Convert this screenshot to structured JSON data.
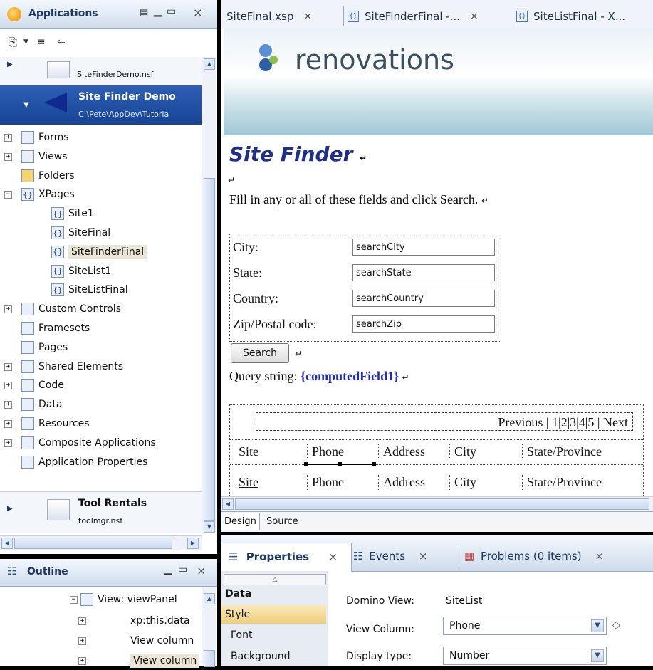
{
  "app_panel": {
    "title": "Applications",
    "toolbar_icons": [
      "new-icon",
      "filter-icon",
      "collapse-icon"
    ],
    "db_items": [
      {
        "name": "SiteFinderDemo.nsf"
      },
      {
        "title": "Site Finder Demo",
        "path": "C:\\Pete\\AppDev\\Tutoria"
      },
      {
        "title": "Tool Rentals",
        "path": "toolmgr.nsf"
      }
    ],
    "tree": [
      {
        "label": "Forms",
        "icon": "form-icon",
        "expand": "+"
      },
      {
        "label": "Views",
        "icon": "view-icon",
        "expand": "+"
      },
      {
        "label": "Folders",
        "icon": "folder-icon",
        "expand": ""
      },
      {
        "label": "XPages",
        "icon": "xpage-icon",
        "expand": "−"
      },
      {
        "label": "Site1",
        "icon": "xpage-icon",
        "expand": "",
        "indent": 1
      },
      {
        "label": "SiteFinal",
        "icon": "xpage-icon",
        "expand": "",
        "indent": 1
      },
      {
        "label": "SiteFinderFinal",
        "icon": "xpage-icon",
        "expand": "",
        "indent": 1,
        "selected": true
      },
      {
        "label": "SiteList1",
        "icon": "xpage-icon",
        "expand": "",
        "indent": 1
      },
      {
        "label": "SiteListFinal",
        "icon": "xpage-icon",
        "expand": "",
        "indent": 1
      },
      {
        "label": "Custom Controls",
        "icon": "custom-control-icon",
        "expand": "+"
      },
      {
        "label": "Framesets",
        "icon": "frameset-icon",
        "expand": ""
      },
      {
        "label": "Pages",
        "icon": "page-icon",
        "expand": ""
      },
      {
        "label": "Shared Elements",
        "icon": "shared-elements-icon",
        "expand": "+"
      },
      {
        "label": "Code",
        "icon": "code-icon",
        "expand": "+"
      },
      {
        "label": "Data",
        "icon": "data-icon",
        "expand": "+"
      },
      {
        "label": "Resources",
        "icon": "resources-icon",
        "expand": "+"
      },
      {
        "label": "Composite Applications",
        "icon": "composite-icon",
        "expand": "+"
      },
      {
        "label": "Application Properties",
        "icon": "properties-icon",
        "expand": ""
      }
    ]
  },
  "outline_panel": {
    "title": "Outline",
    "items": [
      {
        "label": "View: viewPanel",
        "expand": "−"
      },
      {
        "label": "xp:this.data",
        "expand": "+"
      },
      {
        "label": "View column",
        "expand": "+"
      },
      {
        "label": "View column",
        "expand": "+",
        "selected": true
      }
    ]
  },
  "editor": {
    "tabs": [
      {
        "label": "SiteFinal.xsp",
        "close": "×"
      },
      {
        "label": "SiteFinderFinal -...",
        "close": "×"
      },
      {
        "label": "SiteListFinal - X...",
        "close": ""
      }
    ],
    "banner_text": "renovations",
    "heading": "Site Finder",
    "intro": "Fill in any or all of these fields and click Search.",
    "para_mark": "↵",
    "form_fields": [
      {
        "label": "City:",
        "value": "searchCity"
      },
      {
        "label": "State:",
        "value": "searchState"
      },
      {
        "label": "Country:",
        "value": "searchCountry"
      },
      {
        "label": "Zip/Postal code:",
        "value": "searchZip"
      }
    ],
    "search_button": "Search",
    "query_label": "Query string:",
    "query_field": "{computedField1}",
    "pager": {
      "previous": "Previous",
      "pages": [
        "1",
        "2",
        "3",
        "4",
        "5"
      ],
      "next": "Next"
    },
    "table_header": [
      "Site",
      "Phone",
      "Address",
      "City",
      "State/Province"
    ],
    "table_row": [
      "Site",
      "Phone",
      "Address",
      "City",
      "State/Province"
    ],
    "bottom_tabs": [
      "Design",
      "Source"
    ]
  },
  "props_panel": {
    "tabs": [
      {
        "label": "Properties",
        "icon": "properties-icon",
        "close": "×"
      },
      {
        "label": "Events",
        "icon": "events-icon",
        "close": "×"
      },
      {
        "label": "Problems (0 items)",
        "icon": "problems-icon",
        "close": "×"
      }
    ],
    "categories": [
      "Data",
      "Style",
      "Font",
      "Background"
    ],
    "fields": [
      {
        "label": "Domino View:",
        "value": "SiteList",
        "type": "text"
      },
      {
        "label": "View Column:",
        "value": "Phone",
        "type": "select"
      },
      {
        "label": "Display type:",
        "value": "Number",
        "type": "select"
      }
    ]
  }
}
